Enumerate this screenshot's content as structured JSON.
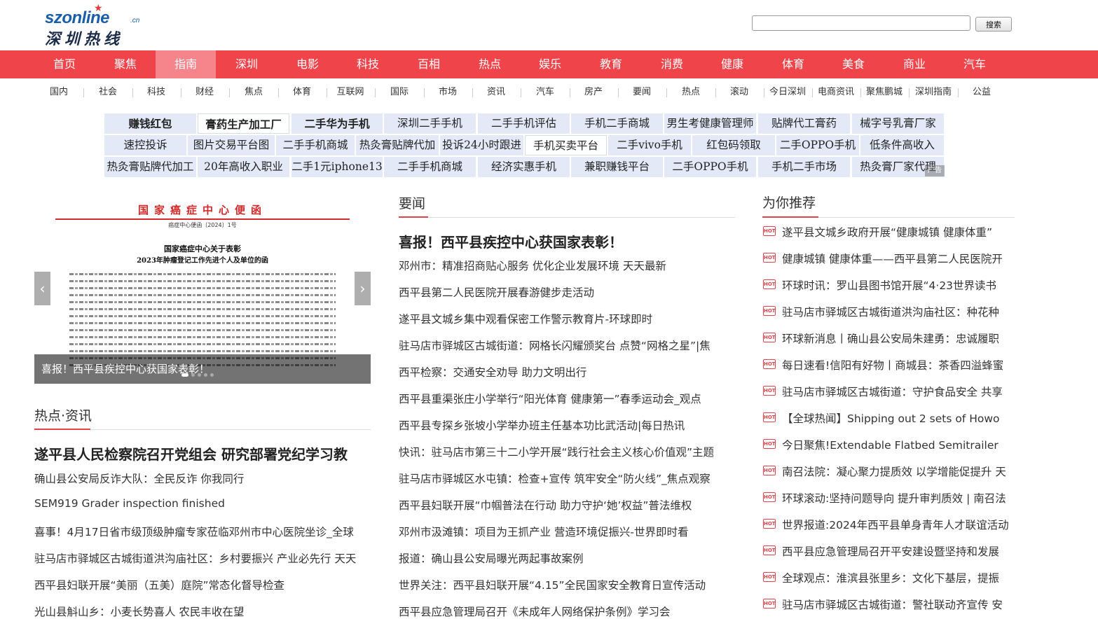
{
  "logo": {
    "en": "szonline",
    "cn_suffix": ".cn",
    "zh": "深圳热线"
  },
  "search": {
    "placeholder": "",
    "button": "搜索"
  },
  "mainnav": [
    "首页",
    "聚焦",
    "指南",
    "深圳",
    "电影",
    "科技",
    "百相",
    "热点",
    "娱乐",
    "教育",
    "消费",
    "健康",
    "体育",
    "美食",
    "商业",
    "汽车"
  ],
  "mainnav_active": "指南",
  "subnav": [
    "国内",
    "社会",
    "科技",
    "财经",
    "焦点",
    "体育",
    "互联网",
    "国际",
    "市场",
    "资讯",
    "汽车",
    "房产",
    "要闻",
    "热点",
    "滚动",
    "今日深圳",
    "电商资讯",
    "聚焦鹏城",
    "深圳指南",
    "公益"
  ],
  "ads": {
    "row1": [
      "赚钱红包",
      "膏药生产加工厂",
      "二手华为手机",
      "深圳二手手机",
      "二手手机评估",
      "手机二手商城",
      "男生考健康管理师",
      "贴牌代工膏药",
      "械字号乳膏厂家"
    ],
    "row2": [
      "速控投诉",
      "图片交易平台图",
      "二手手机商城",
      "热灸膏贴牌代加",
      "投诉24小时跟进",
      "手机买卖平台",
      "二手vivo手机",
      "红包码领取",
      "二手OPPO手机",
      "低条件高收入"
    ],
    "row3": [
      "热灸膏贴牌代加工",
      "20年高收入职业",
      "二手1元iphone13",
      "二手手机商城",
      "经济实惠手机",
      "兼职赚钱平台",
      "二手OPPO手机",
      "手机二手市场",
      "热灸膏厂家代理"
    ],
    "tag": "广告"
  },
  "carousel": {
    "doc_head": "国家癌症中心便函",
    "doc_num": "癌症中心便函〔2024〕1号",
    "doc_title1": "国家癌症中心关于表彰",
    "doc_title2": "2023年肿瘤登记工作先进个人及单位的函",
    "caption": "喜报！西平县疾控中心获国家表彰！",
    "prev": "‹",
    "next": "›"
  },
  "hot": {
    "title": "热点·资讯",
    "lead": "遂平县人民检察院召开党组会 研究部署党纪学习教",
    "items": [
      "确山县公安局反诈大队：全民反诈 你我同行",
      "SEM919 Grader inspection finished",
      "喜事！4月17日省市级顶级肿瘤专家莅临邓州市中心医院坐诊_全球",
      "驻马店市驿城区古城街道洪沟庙社区：乡村要振兴 产业必先行 天天",
      "西平县妇联开展“美丽（五美）庭院”常态化督导检查",
      "光山县斛山乡：小麦长势喜人 农民丰收在望"
    ]
  },
  "important": {
    "title": "要闻",
    "lead": "喜报！西平县疾控中心获国家表彰！",
    "items": [
      "邓州市：精准招商贴心服务 优化企业发展环境 天天最新",
      "西平县第二人民医院开展春游健步走活动",
      "遂平县文城乡集中观看保密工作警示教育片-环球即时",
      "驻马店市驿城区古城街道：网格长闪耀颁奖台 点赞“网格之星”|焦",
      "西平检察：交通安全劝导 助力文明出行",
      "西平县重渠张庄小学举行“阳光体育 健康第一”春季运动会_观点",
      "西平县专探乡张坡小学举办班主任基本功比武活动|每日热讯",
      "快讯：驻马店市第三十二小学开展“践行社会主义核心价值观”主题",
      "驻马店市驿城区水屯镇：检查+宣传 筑牢安全“防火线”_焦点观察",
      "西平县妇联开展“巾帼普法在行动 助力守护‘她’权益”普法维权",
      "邓州市汲滩镇：项目为王抓产业 营造环境促振兴-世界即时看",
      "报道：确山县公安局曝光两起事故案例",
      "世界关注：西平县妇联开展“4.15”全民国家安全教育日宣传活动",
      "西平县应急管理局召开《未成年人网络保护条例》学习会"
    ]
  },
  "recommend": {
    "title": "为你推荐",
    "hot_label": "HOT",
    "items": [
      "遂平县文城乡政府开展“健康城镇 健康体重”",
      "健康城镇 健康体重——西平县第二人民医院开",
      "环球时讯：罗山县图书馆开展“4·23世界读书",
      "驻马店市驿城区古城街道洪沟庙社区：种花种",
      "环球新消息丨确山县公安局朱建勇：忠诚履职",
      "每日速看!信阳有好物丨商城县：茶香四溢蜂蜜",
      "驻马店市驿城区古城街道：守护食品安全 共享",
      "【全球热闻】Shipping out 2 sets of Howo",
      "今日聚焦!Extendable Flatbed Semitrailer",
      "南召法院：凝心聚力提质效 以学增能促提升 天",
      "环球滚动:坚持问题导向 提升审判质效 | 南召法",
      "世界报道:2024年西平县单身青年人才联谊活动",
      "西平县应急管理局召开平安建设暨坚持和发展",
      "全球观点：淮滨县张里乡：文化下基层，提振",
      "驻马店市驿城区古城街道：警社联动齐宣传 安"
    ]
  }
}
